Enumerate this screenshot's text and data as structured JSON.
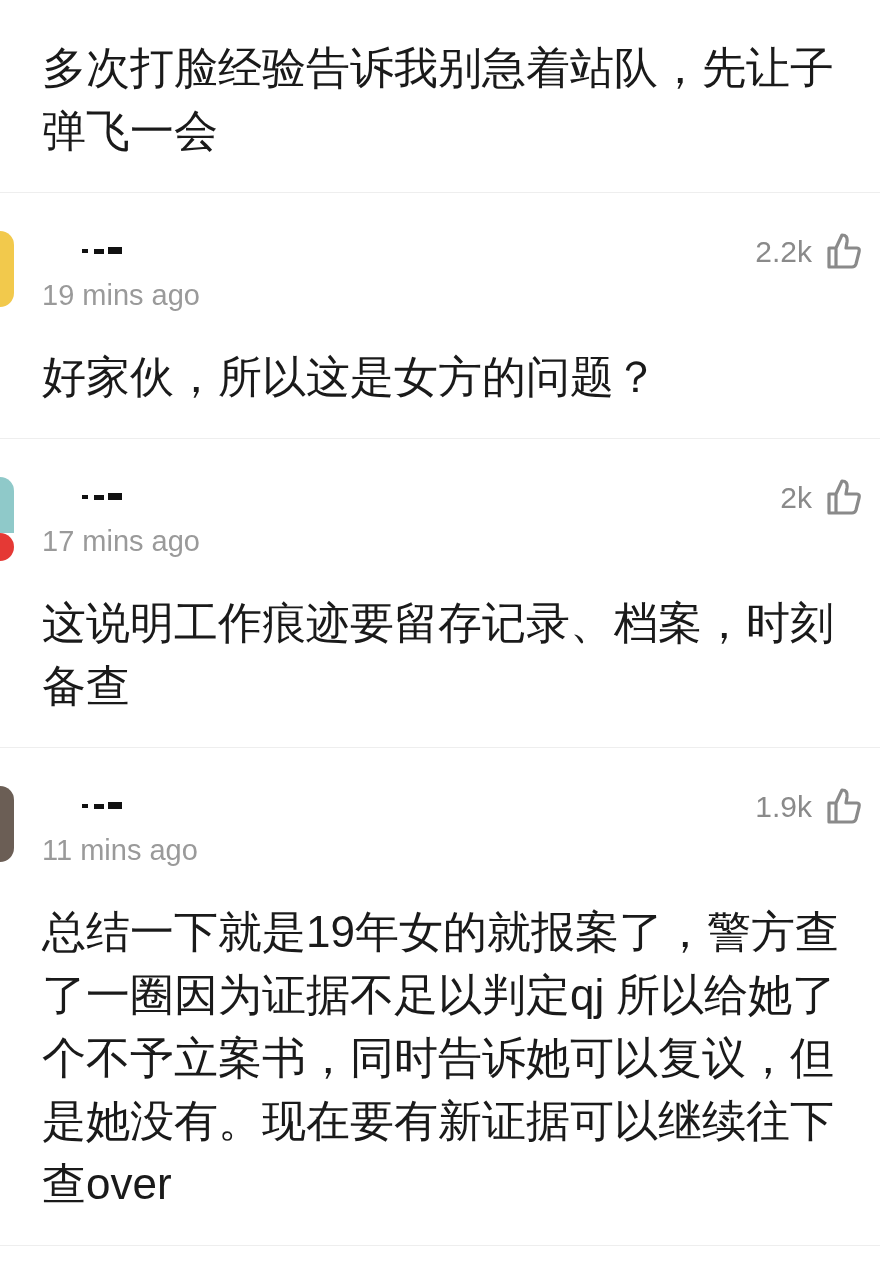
{
  "comments": [
    {
      "text": "多次打脸经验告诉我别急着站队，先让子弹飞一会"
    },
    {
      "likes": "2.2k",
      "time": "19 mins ago",
      "avatar": {
        "color": "#f2c94c",
        "badge": false
      },
      "text": "好家伙，所以这是女方的问题？"
    },
    {
      "likes": "2k",
      "time": "17 mins ago",
      "avatar": {
        "color": "#8fc9c9",
        "badge": true
      },
      "text": "这说明工作痕迹要留存记录、档案，时刻备查"
    },
    {
      "likes": "1.9k",
      "time": "11 mins ago",
      "avatar": {
        "color": "#6b5e55",
        "badge": false
      },
      "text": "总结一下就是19年女的就报案了，警方查了一圈因为证据不足以判定qj 所以给她了个不予立案书，同时告诉她可以复议，但是她没有。现在要有新证据可以继续往下查over"
    }
  ]
}
